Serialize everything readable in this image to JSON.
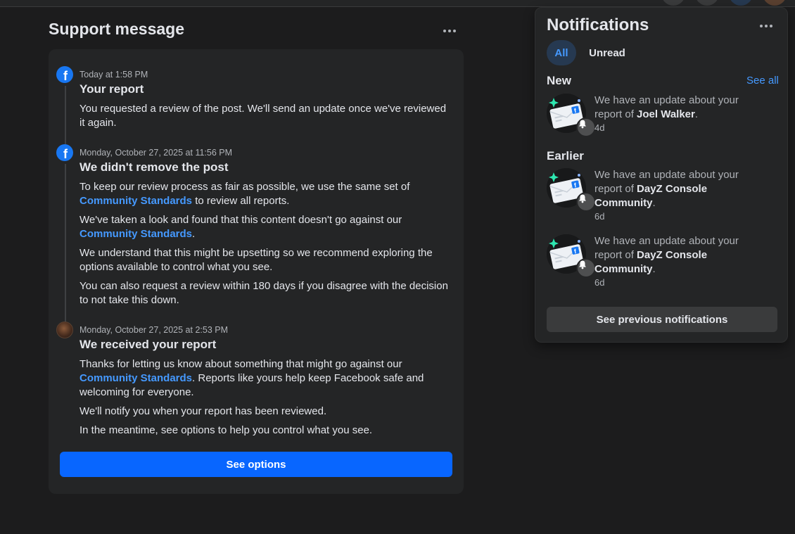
{
  "support": {
    "title": "Support message",
    "entries": [
      {
        "time": "Today at 1:58 PM",
        "heading": "Your report",
        "p1": "You requested a review of the post. We'll send an update once we've reviewed it again."
      },
      {
        "time": "Monday, October 27, 2025 at 11:56 PM",
        "heading": "We didn't remove the post",
        "p1_pre": "To keep our review process as fair as possible, we use the same set of ",
        "p1_link": "Community Standards",
        "p1_post": " to review all reports.",
        "p2_pre": "We've taken a look and found that this content doesn't go against our ",
        "p2_link": "Community Standards",
        "p2_post": ".",
        "p3": "We understand that this might be upsetting so we recommend exploring the options available to control what you see.",
        "p4": "You can also request a review within 180 days if you disagree with the decision to not take this down."
      },
      {
        "time": "Monday, October 27, 2025 at 2:53 PM",
        "heading": "We received your report",
        "p1_pre": "Thanks for letting us know about something that might go against our ",
        "p1_link": "Community Standards",
        "p1_post": ". Reports like yours help keep Facebook safe and welcoming for everyone.",
        "p2": "We'll notify you when your report has been reviewed.",
        "p3": "In the meantime, see options to help you control what you see."
      }
    ],
    "see_options_label": "See options"
  },
  "notifications": {
    "title": "Notifications",
    "tabs": {
      "all": "All",
      "unread": "Unread"
    },
    "new_label": "New",
    "see_all_label": "See all",
    "earlier_label": "Earlier",
    "items": [
      {
        "pre": "We have an update about your report of ",
        "bold": "Joel Walker",
        "post": ".",
        "age": "4d"
      },
      {
        "pre": "We have an update about your report of ",
        "bold": "DayZ Console Community",
        "post": ".",
        "age": "6d"
      },
      {
        "pre": "We have an update about your report of ",
        "bold": "DayZ Console Community",
        "post": ".",
        "age": "6d"
      }
    ],
    "see_previous_label": "See previous notifications"
  },
  "colors": {
    "background": "#1c1c1d",
    "card": "#242526",
    "accent_link": "#4599ff",
    "primary_button": "#0866ff"
  }
}
